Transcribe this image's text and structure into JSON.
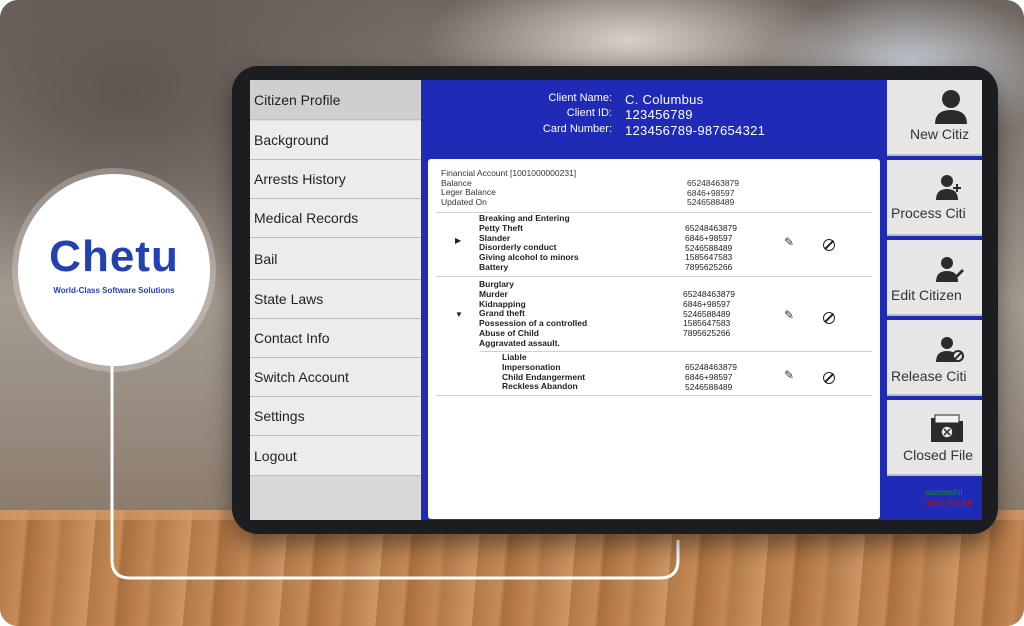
{
  "brand": {
    "name": "Chetu",
    "tagline": "World-Class Software Solutions",
    "color": "#2341b3"
  },
  "sidebar": {
    "items": [
      {
        "label": "Citizen Profile"
      },
      {
        "label": "Background"
      },
      {
        "label": "Arrests History"
      },
      {
        "label": "Medical Records"
      },
      {
        "label": "Bail"
      },
      {
        "label": "State Laws"
      },
      {
        "label": "Contact Info"
      },
      {
        "label": "Switch Account"
      },
      {
        "label": "Settings"
      },
      {
        "label": "Logout"
      }
    ]
  },
  "header": {
    "client_name_label": "Client Name:",
    "client_name": "C. Columbus",
    "client_id_label": "Client ID:",
    "client_id": "123456789",
    "card_number_label": "Card Number:",
    "card_number": "123456789-987654321"
  },
  "account": {
    "title": "Financial Account [1001000000231]",
    "balance_label": "Balance",
    "balance": "65248463879",
    "leger_label": "Leger Balance",
    "leger": "6846+98597",
    "updated_label": "Updated On",
    "updated": "5246588489"
  },
  "groups": [
    {
      "items": [
        "Breaking and Entering",
        "Petty Theft",
        "Slander",
        "Disorderly conduct",
        "Giving alcohol to minors",
        "Battery"
      ],
      "values": [
        "65248463879",
        "6846+98597",
        "5246588489",
        "1585647583",
        "7895625266"
      ]
    },
    {
      "items": [
        "Burglary",
        "Murder",
        "Kidnapping",
        "Grand theft",
        "Possession of a controlled",
        "Abuse of Child",
        "Aggravated assault."
      ],
      "values": [
        "65248463879",
        "6846+98597",
        "5246588489",
        "1585647583",
        "7895625266"
      ]
    },
    {
      "items": [
        "Liable",
        "Impersonation",
        "Child Endangerment",
        "Reckless Abandon"
      ],
      "values": [
        "65248463879",
        "6846+98597",
        "5246588489"
      ]
    }
  ],
  "actions": [
    {
      "label": "New Citiz",
      "icon": "person-icon"
    },
    {
      "label": "Process Citi",
      "icon": "person-add-icon"
    },
    {
      "label": "Edit Citizen",
      "icon": "person-edit-icon"
    },
    {
      "label": "Release Citi",
      "icon": "person-block-icon"
    },
    {
      "label": "Closed File",
      "icon": "folder-close-icon"
    }
  ],
  "status": {
    "success": "successful",
    "fail": "unsuccessful"
  },
  "colors": {
    "screen_bg": "#1f2bb6",
    "sidebar_bg": "#dcdcdc",
    "success": "#1a8f28",
    "fail": "#b21a1a"
  }
}
